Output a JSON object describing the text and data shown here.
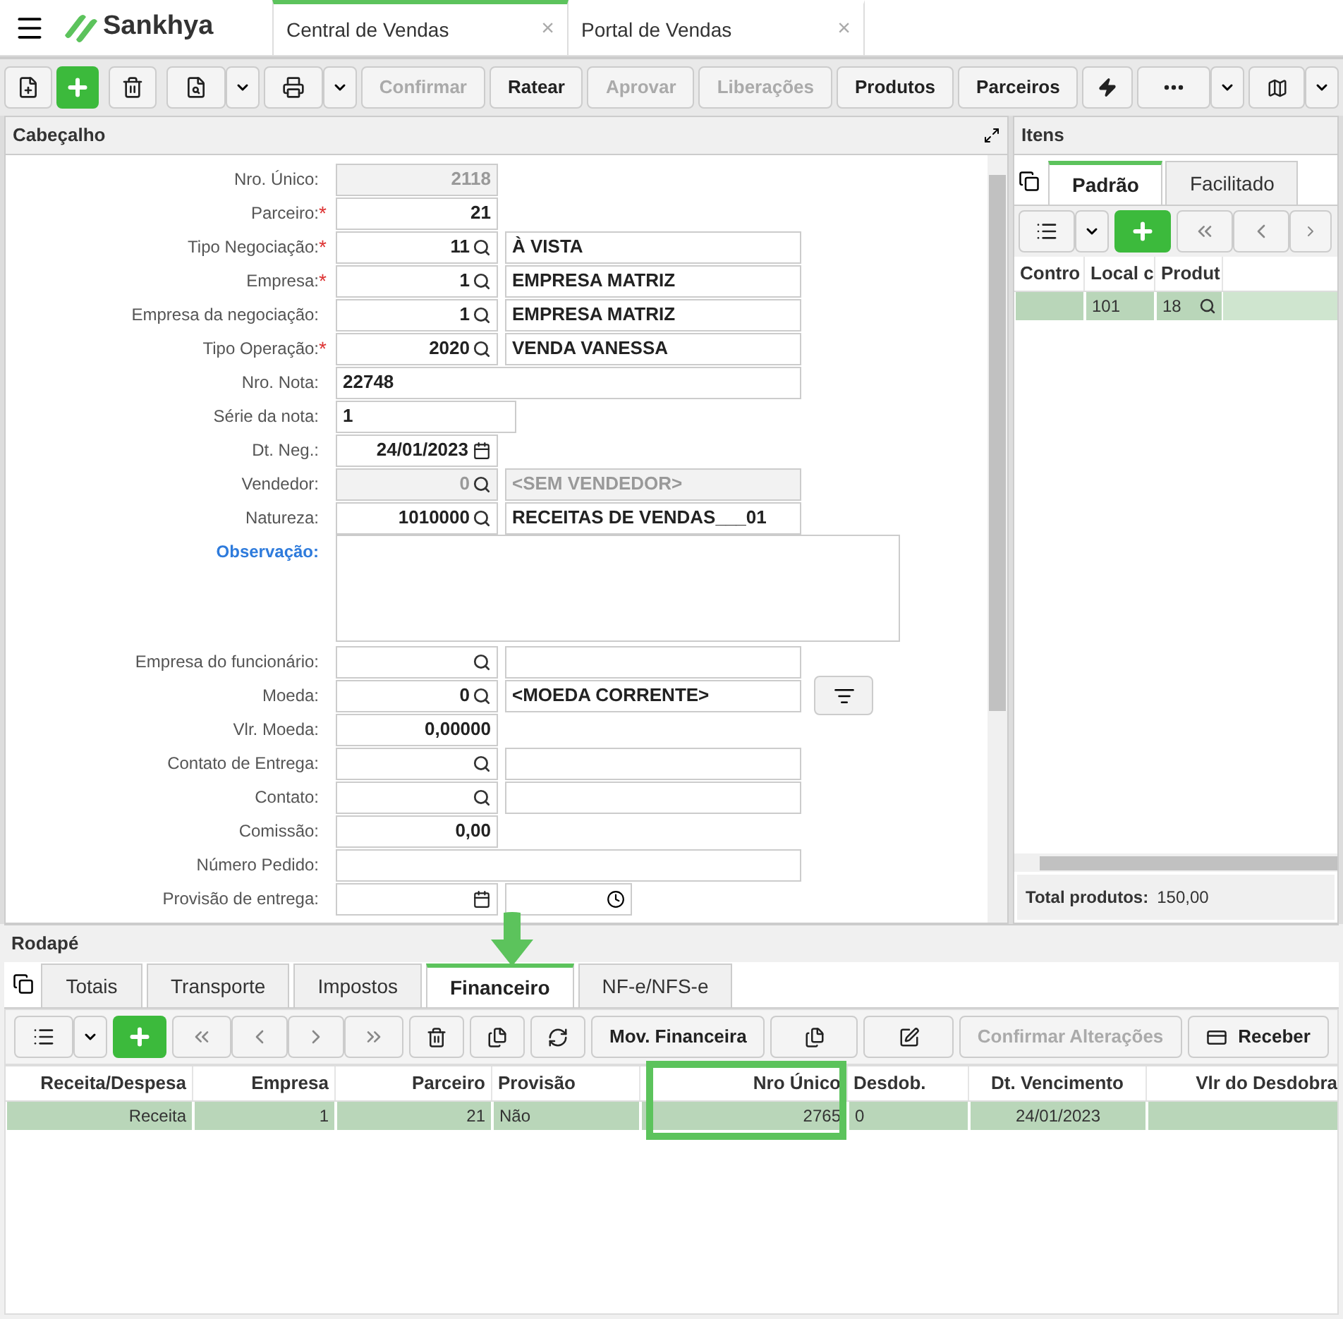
{
  "app": {
    "brand": "Sankhya"
  },
  "tabs": [
    {
      "label": "Central de Vendas",
      "selected": true,
      "close": "×"
    },
    {
      "label": "Portal de Vendas",
      "selected": false,
      "close": "×"
    }
  ],
  "toolbar": [
    {
      "label": "Confirmar",
      "disabled": true
    },
    {
      "label": "Ratear",
      "disabled": false
    },
    {
      "label": "Aprovar",
      "disabled": true
    },
    {
      "label": "Liberações",
      "disabled": true
    },
    {
      "label": "Produtos",
      "disabled": false
    },
    {
      "label": "Parceiros",
      "disabled": false
    }
  ],
  "header_panel": {
    "title": "Cabeçalho",
    "fields": [
      {
        "kind": "plain",
        "label": "Nro. Único:",
        "required": false,
        "disabled": true,
        "value": "2118"
      },
      {
        "kind": "plain",
        "label": "Parceiro:",
        "required": true,
        "required_mark": "*",
        "disabled": false,
        "value": "21"
      },
      {
        "kind": "lookup",
        "label": "Tipo Negociação:",
        "required": true,
        "required_mark": "*",
        "disabled": false,
        "value": "11",
        "description": "À VISTA"
      },
      {
        "kind": "lookup",
        "label": "Empresa:",
        "required": true,
        "required_mark": "*",
        "disabled": false,
        "value": "1",
        "description": "EMPRESA MATRIZ"
      },
      {
        "kind": "lookup",
        "label": "Empresa da negociação:",
        "required": false,
        "disabled": false,
        "value": "1",
        "description": "EMPRESA MATRIZ"
      },
      {
        "kind": "lookup",
        "label": "Tipo Operação:",
        "required": true,
        "required_mark": "*",
        "disabled": false,
        "value": "2020",
        "description": "VENDA VANESSA"
      },
      {
        "kind": "wide",
        "label": "Nro. Nota:",
        "required": false,
        "disabled": false,
        "value": "22748"
      },
      {
        "kind": "medium",
        "label": "Série da nota:",
        "required": false,
        "disabled": false,
        "value": "1"
      },
      {
        "kind": "date",
        "label": "Dt. Neg.:",
        "required": false,
        "disabled": false,
        "value": "24/01/2023"
      },
      {
        "kind": "lookup",
        "label": "Vendedor:",
        "required": false,
        "disabled": true,
        "value": "0",
        "description": "<SEM VENDEDOR>"
      },
      {
        "kind": "lookup",
        "label": "Natureza:",
        "required": false,
        "disabled": false,
        "value": "1010000",
        "description": "RECEITAS DE VENDAS___01"
      },
      {
        "kind": "textarea",
        "label": "Observação:",
        "required": false,
        "disabled": false
      },
      {
        "kind": "lookup",
        "label": "Empresa do funcionário:",
        "required": false,
        "disabled": false
      },
      {
        "kind": "lookup",
        "label": "Moeda:",
        "required": false,
        "disabled": false,
        "value": "0",
        "description": "<MOEDA CORRENTE>",
        "extra_button": true
      },
      {
        "kind": "plain",
        "label": "Vlr. Moeda:",
        "required": false,
        "disabled": false,
        "value": "0,00000"
      },
      {
        "kind": "lookup",
        "label": "Contato de Entrega:",
        "required": false,
        "disabled": false
      },
      {
        "kind": "lookup",
        "label": "Contato:",
        "required": false,
        "disabled": false
      },
      {
        "kind": "plain",
        "label": "Comissão:",
        "required": false,
        "disabled": false,
        "value": "0,00"
      },
      {
        "kind": "wide",
        "label": "Número Pedido:",
        "required": false,
        "disabled": false
      },
      {
        "kind": "datetime",
        "label": "Provisão de entrega:",
        "required": false,
        "disabled": false
      }
    ]
  },
  "items_panel": {
    "title": "Itens",
    "tabs": [
      {
        "label": "Padrão",
        "selected": true
      },
      {
        "label": "Facilitado",
        "selected": false
      }
    ],
    "columns": [
      "Contro",
      "Local c",
      "Produt"
    ],
    "rows": [
      {
        "selected": true,
        "cells": [
          "",
          "101",
          "18"
        ]
      }
    ],
    "total_label": "Total produtos:",
    "total_value": "150,00"
  },
  "footer_panel": {
    "title": "Rodapé",
    "tabs": [
      {
        "label": "Totais",
        "selected": false
      },
      {
        "label": "Transporte",
        "selected": false
      },
      {
        "label": "Impostos",
        "selected": false
      },
      {
        "label": "Financeiro",
        "selected": true
      },
      {
        "label": "NF-e/NFS-e",
        "selected": false
      }
    ],
    "toolbar": [
      {
        "label": "Mov. Financeira",
        "disabled": false
      },
      {
        "label": "Confirmar Alterações",
        "disabled": true
      },
      {
        "label": "Receber",
        "disabled": false
      }
    ],
    "columns": [
      "Receita/Despesa",
      "Empresa",
      "Parceiro",
      "Provisão",
      "Nro Único",
      "Desdob.",
      "Dt. Vencimento",
      "Vlr do Desdobra"
    ],
    "rows": [
      {
        "selected": true,
        "cells": [
          "Receita",
          "1",
          "21",
          "Não",
          "2765",
          "0",
          "24/01/2023",
          ""
        ]
      }
    ]
  }
}
